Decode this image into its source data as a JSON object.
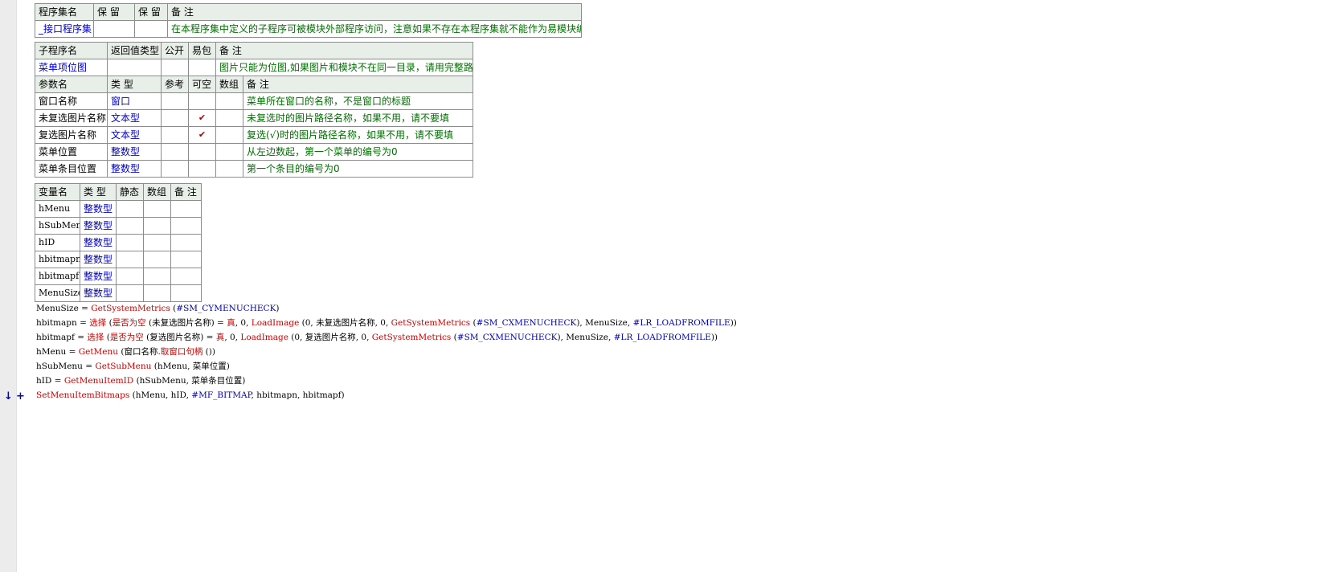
{
  "assembly_table": {
    "headers": [
      "程序集名",
      "保 留",
      "保 留",
      "备 注"
    ],
    "row": {
      "name": "_接口程序集",
      "r1": "",
      "r2": "",
      "note": "在本程序集中定义的子程序可被模块外部程序访问，注意如果不存在本程序集就不能作为易模块编译。"
    }
  },
  "sub_table": {
    "headers": [
      "子程序名",
      "返回值类型",
      "公开",
      "易包",
      "备 注"
    ],
    "row": {
      "name": "菜单项位图",
      "ret": "",
      "public": "",
      "pkg": "",
      "note": "图片只能为位图,如果图片和模块不在同一目录，请用完整路径"
    },
    "param_headers": [
      "参数名",
      "类 型",
      "参考",
      "可空",
      "数组",
      "备 注"
    ],
    "params": [
      {
        "name": "窗口名称",
        "type": "窗口",
        "ref": "",
        "nullable": "",
        "array": "",
        "note": "菜单所在窗口的名称，不是窗口的标题"
      },
      {
        "name": "未复选图片名称",
        "type": "文本型",
        "ref": "",
        "nullable": "✔",
        "array": "",
        "note": "未复选时的图片路径名称，如果不用，请不要填"
      },
      {
        "name": "复选图片名称",
        "type": "文本型",
        "ref": "",
        "nullable": "✔",
        "array": "",
        "note": "复选(√)时的图片路径名称，如果不用，请不要填"
      },
      {
        "name": "菜单位置",
        "type": "整数型",
        "ref": "",
        "nullable": "",
        "array": "",
        "note": "从左边数起，第一个菜单的编号为0"
      },
      {
        "name": "菜单条目位置",
        "type": "整数型",
        "ref": "",
        "nullable": "",
        "array": "",
        "note": "第一个条目的编号为0"
      }
    ]
  },
  "var_table": {
    "headers": [
      "变量名",
      "类 型",
      "静态",
      "数组",
      "备 注"
    ],
    "rows": [
      {
        "name": "hMenu",
        "type": "整数型"
      },
      {
        "name": "hSubMenu",
        "type": "整数型"
      },
      {
        "name": "hID",
        "type": "整数型"
      },
      {
        "name": "hbitmapn",
        "type": "整数型"
      },
      {
        "name": "hbitmapf",
        "type": "整数型"
      },
      {
        "name": "MenuSize",
        "type": "整数型"
      }
    ]
  },
  "code_lines": [
    {
      "a": "MenuSize ",
      "b": "= ",
      "c": "GetSystemMetrics",
      "d": " (",
      "e": "#SM_CYMENUCHECK",
      "f": ")"
    },
    {
      "a": "hbitmapn ",
      "b": "= ",
      "c": "选择",
      "d": " (",
      "e": "是否为空",
      "f": " (未复选图片名称) = ",
      "g": "真",
      "h": ", 0, ",
      "i": "LoadImage",
      "j": " (0, 未复选图片名称, 0, ",
      "k": "GetSystemMetrics",
      "l": " (",
      "m": "#SM_CXMENUCHECK",
      "n": "), MenuSize, ",
      "o": "#LR_LOADFROMFILE",
      "p": "))"
    },
    {
      "a": "hbitmapf ",
      "b": "= ",
      "c": "选择",
      "d": " (",
      "e": "是否为空",
      "f": " (复选图片名称) = ",
      "g": "真",
      "h": ", 0, ",
      "i": "LoadImage",
      "j": " (0, 复选图片名称, 0, ",
      "k": "GetSystemMetrics",
      "l": " (",
      "m": "#SM_CXMENUCHECK",
      "n": "), MenuSize, ",
      "o": "#LR_LOADFROMFILE",
      "p": "))"
    },
    {
      "a": "hMenu ",
      "b": "= ",
      "c": "GetMenu",
      "d": " (窗口名称.",
      "e": "取窗口句柄",
      "f": " ())"
    },
    {
      "a": "hSubMenu ",
      "b": "= ",
      "c": "GetSubMenu",
      "d": " (hMenu, 菜单位置)"
    },
    {
      "a": "hID ",
      "b": "= ",
      "c": "GetMenuItemID",
      "d": " (hSubMenu, 菜单条目位置)"
    },
    {
      "a": "",
      "b": "",
      "c": "SetMenuItemBitmaps",
      "d": " (hMenu, hID, ",
      "e": "#MF_BITMAP",
      "f": ", hbitmapn, hbitmapf)"
    }
  ],
  "gutter_markers": {
    "arrow": "↓",
    "plus": "+"
  }
}
